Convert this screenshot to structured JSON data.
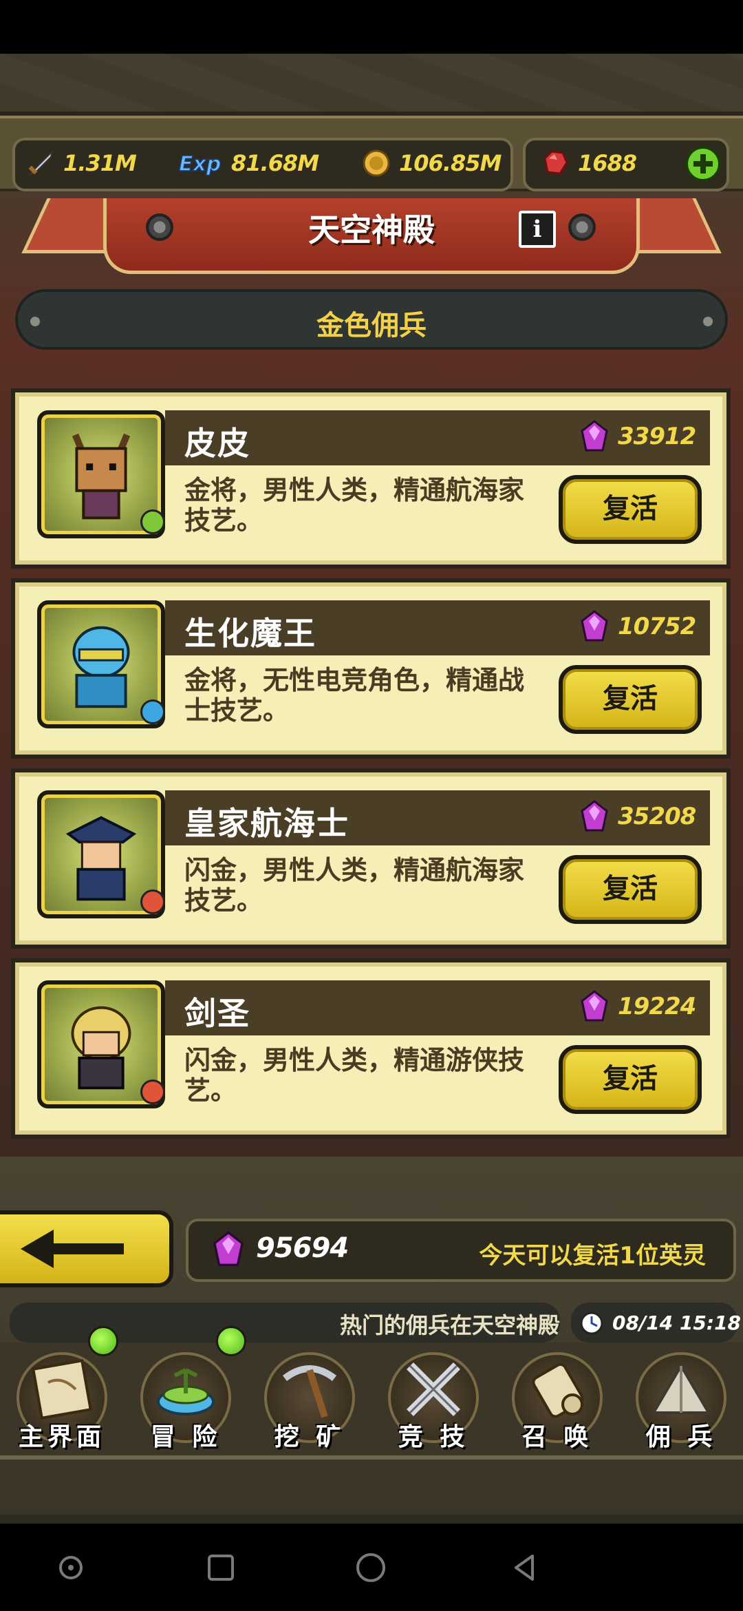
{
  "resources": {
    "power": "1.31M",
    "exp": "81.68M",
    "gold": "106.85M",
    "rubies": "1688"
  },
  "header": {
    "title": "天空神殿",
    "category": "金色佣兵"
  },
  "heroes": [
    {
      "name": "皮皮",
      "cost": "33912",
      "desc": "金将，男性人类，精通航海家技艺。",
      "button": "复活",
      "badge_color": "#7ec83a"
    },
    {
      "name": "生化魔王",
      "cost": "10752",
      "desc": "金将，无性电竞角色，精通战士技艺。",
      "button": "复活",
      "badge_color": "#3fa7e0"
    },
    {
      "name": "皇家航海士",
      "cost": "35208",
      "desc": "闪金，男性人类，精通航海家技艺。",
      "button": "复活",
      "badge_color": "#e0553a"
    },
    {
      "name": "剑圣",
      "cost": "19224",
      "desc": "闪金，男性人类，精通游侠技艺。",
      "button": "复活",
      "badge_color": "#e0553a"
    }
  ],
  "footer": {
    "gem_total": "95694",
    "revive_note": "今天可以复活1位英灵",
    "ticker": "热门的佣兵在天空神殿",
    "datetime": "08/14 15:18"
  },
  "nav": {
    "items": [
      {
        "label": "主界面",
        "icon": "scroll-map-icon"
      },
      {
        "label": "冒 险",
        "icon": "island-icon"
      },
      {
        "label": "挖 矿",
        "icon": "pickaxe-icon"
      },
      {
        "label": "竞 技",
        "icon": "crossed-swords-icon"
      },
      {
        "label": "召 唤",
        "icon": "summon-scroll-icon"
      },
      {
        "label": "佣 兵",
        "icon": "tent-icon"
      }
    ]
  }
}
